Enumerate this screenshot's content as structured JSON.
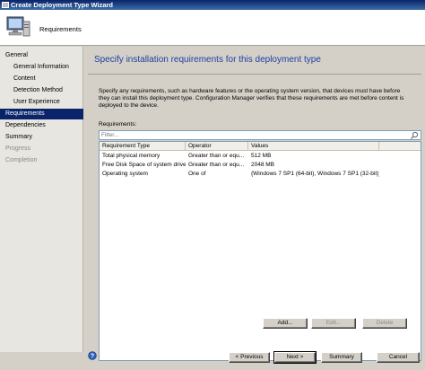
{
  "window": {
    "title": "Create Deployment Type Wizard"
  },
  "banner": {
    "title": "Requirements",
    "icon": "computer-icon"
  },
  "sidebar": {
    "items": [
      {
        "label": "General",
        "level": 1,
        "state": "normal"
      },
      {
        "label": "General Information",
        "level": 2,
        "state": "normal"
      },
      {
        "label": "Content",
        "level": 2,
        "state": "normal"
      },
      {
        "label": "Detection Method",
        "level": 2,
        "state": "normal"
      },
      {
        "label": "User Experience",
        "level": 2,
        "state": "normal"
      },
      {
        "label": "Requirements",
        "level": 1,
        "state": "active"
      },
      {
        "label": "Dependencies",
        "level": 1,
        "state": "normal"
      },
      {
        "label": "Summary",
        "level": 1,
        "state": "normal"
      },
      {
        "label": "Progress",
        "level": 1,
        "state": "disabled"
      },
      {
        "label": "Completion",
        "level": 1,
        "state": "disabled"
      }
    ]
  },
  "main": {
    "heading": "Specify installation requirements for this deployment type",
    "description": "Specify any requirements, such as hardware features or the operating system version, that devices must have before they can install this deployment type. Configuration Manager verifies that these requirements are met before content is deployed to the device.",
    "requirements_label": "Requirements:",
    "filter_placeholder": "Filter...",
    "table": {
      "columns": [
        "Requirement Type",
        "Operator",
        "Values"
      ],
      "rows": [
        [
          "Total physical memory",
          "Greater than or equ...",
          "512 MB"
        ],
        [
          "Free Disk Space of system drive",
          "Greater than or equ...",
          "2048 MB"
        ],
        [
          "Operating system",
          "One of",
          "{Windows 7 SP1 (64-bit), Windows 7 SP1 (32-bit)}"
        ]
      ]
    },
    "buttons": {
      "add": "Add...",
      "edit": "Edit...",
      "delete": "Delete"
    }
  },
  "footer": {
    "previous": "< Previous",
    "next": "Next >",
    "summary": "Summary",
    "cancel": "Cancel"
  },
  "colors": {
    "accent": "#0a246a",
    "heading": "#1f3fa0"
  }
}
